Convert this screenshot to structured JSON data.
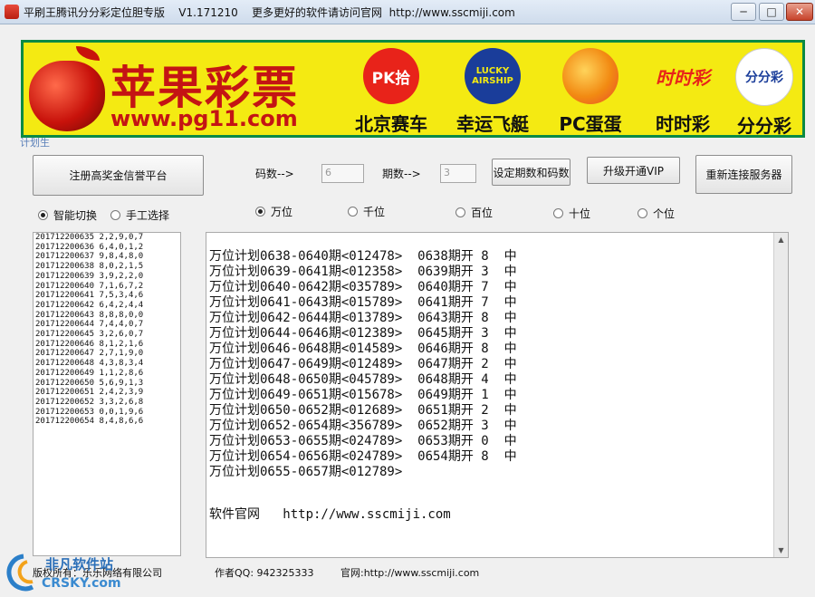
{
  "window": {
    "title": "平刷王腾讯分分彩定位胆专版",
    "version": "V1.171210",
    "tagline": "更多更好的软件请访问官网",
    "site": "http://www.sscmiji.com",
    "controls": {
      "min": "─",
      "max": "□",
      "close": "✕"
    }
  },
  "banner": {
    "brand": "苹果彩票",
    "url": "www.pg11.com",
    "games": [
      {
        "icon": "PK拾",
        "label": "北京赛车",
        "icon_name": "pk10-icon"
      },
      {
        "icon": "LUCKY AIRSHIP",
        "label": "幸运飞艇",
        "icon_name": "lucky-airship-icon"
      },
      {
        "icon": "",
        "label": "PC蛋蛋",
        "icon_name": "egg-icon"
      },
      {
        "icon": "时时彩",
        "label": "时时彩",
        "icon_name": "ssc-icon"
      },
      {
        "icon": "分分彩",
        "label": "分分彩",
        "icon_name": "mark-six-icon"
      }
    ],
    "ghost_text": "计划生"
  },
  "controls": {
    "register_btn": "注册高奖金信誉平台",
    "code_count_label": "码数-->",
    "code_count_value": "6",
    "period_count_label": "期数-->",
    "period_count_value": "3",
    "set_btn": "设定期数和码数",
    "upgrade_btn": "升级开通VIP",
    "reconnect_btn": "重新连接服务器",
    "mode_smart": "智能切换",
    "mode_manual": "手工选择",
    "positions": [
      "万位",
      "千位",
      "百位",
      "十位",
      "个位"
    ]
  },
  "draws": [
    "201712200635 2,2,9,0,7",
    "201712200636 6,4,0,1,2",
    "201712200637 9,8,4,8,0",
    "201712200638 8,0,2,1,5",
    "201712200639 3,9,2,2,0",
    "201712200640 7,1,6,7,2",
    "201712200641 7,5,3,4,6",
    "201712200642 6,4,2,4,4",
    "201712200643 8,8,8,0,0",
    "201712200644 7,4,4,0,7",
    "201712200645 3,2,6,0,7",
    "201712200646 8,1,2,1,6",
    "201712200647 2,7,1,9,0",
    "201712200648 4,3,8,3,4",
    "201712200649 1,1,2,8,6",
    "201712200650 5,6,9,1,3",
    "201712200651 2,4,2,3,9",
    "201712200652 3,3,2,6,8",
    "201712200653 0,0,1,9,6",
    "201712200654 8,4,8,6,6"
  ],
  "plan_lines": [
    "万位计划0638-0640期<012478>  0638期开 8  中",
    "万位计划0639-0641期<012358>  0639期开 3  中",
    "万位计划0640-0642期<035789>  0640期开 7  中",
    "万位计划0641-0643期<015789>  0641期开 7  中",
    "万位计划0642-0644期<013789>  0643期开 8  中",
    "万位计划0644-0646期<012389>  0645期开 3  中",
    "万位计划0646-0648期<014589>  0646期开 8  中",
    "万位计划0647-0649期<012489>  0647期开 2  中",
    "万位计划0648-0650期<045789>  0648期开 4  中",
    "万位计划0649-0651期<015678>  0649期开 1  中",
    "万位计划0650-0652期<012689>  0651期开 2  中",
    "万位计划0652-0654期<356789>  0652期开 3  中",
    "万位计划0653-0655期<024789>  0653期开 0  中",
    "万位计划0654-0656期<024789>  0654期开 8  中",
    "万位计划0655-0657期<012789>"
  ],
  "website_line": "软件官网   http://www.sscmiji.com",
  "footer": {
    "company": "版权所有：乐乐网络有限公司",
    "author": "作者QQ: 942325333",
    "site": "官网:http://www.sscmiji.com"
  },
  "watermark": {
    "cn": "非凡软件站",
    "en": "CRSKY.com"
  }
}
